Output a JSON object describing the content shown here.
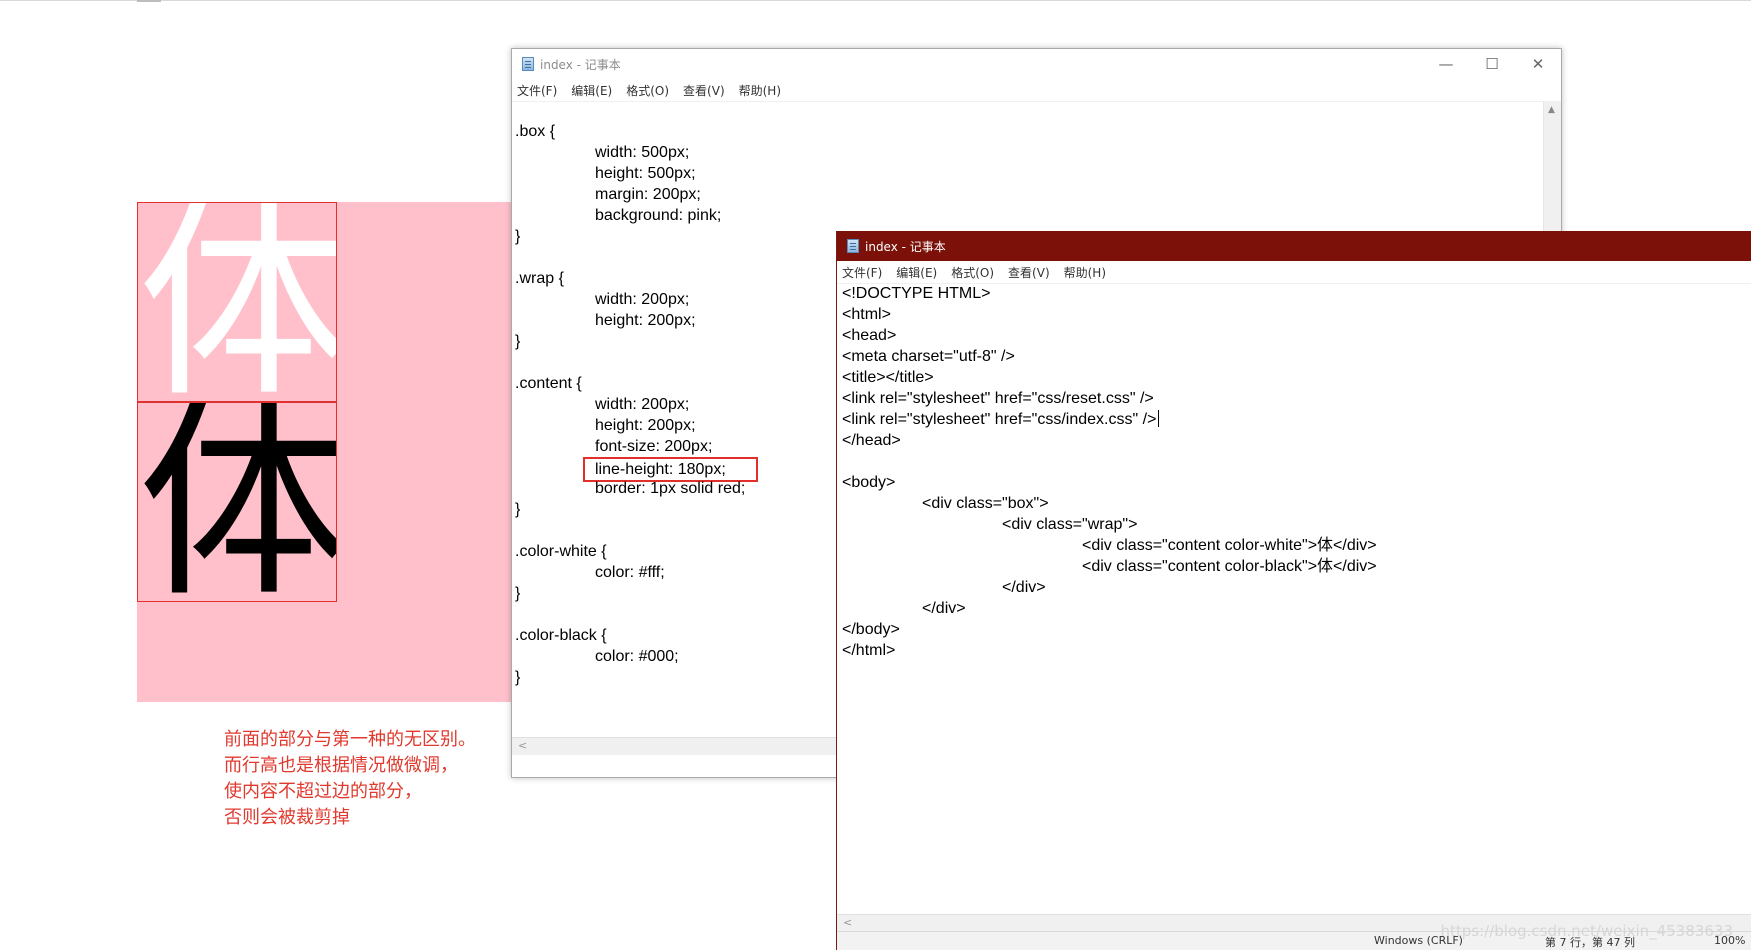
{
  "demo": {
    "white_glyph": "体",
    "black_glyph": "体",
    "caption": [
      "前面的部分与第一种的无区别。",
      "而行高也是根据情况做微调，",
      "使内容不超过边的部分，",
      "否则会被裁剪掉"
    ]
  },
  "window_back": {
    "title": "index - 记事本",
    "menu": [
      "文件(F)",
      "编辑(E)",
      "格式(O)",
      "查看(V)",
      "帮助(H)"
    ],
    "controls": {
      "minimize": "—",
      "maximize": "☐",
      "close": "✕"
    },
    "highlighted_line": "line-height: 180px;",
    "code": [
      {
        "indent": 0,
        "text": ".box {"
      },
      {
        "indent": 1,
        "text": "width: 500px;"
      },
      {
        "indent": 1,
        "text": "height: 500px;"
      },
      {
        "indent": 1,
        "text": "margin: 200px;"
      },
      {
        "indent": 1,
        "text": "background: pink;"
      },
      {
        "indent": 0,
        "text": "}"
      },
      {
        "indent": 0,
        "text": ""
      },
      {
        "indent": 0,
        "text": ".wrap {"
      },
      {
        "indent": 1,
        "text": "width: 200px;"
      },
      {
        "indent": 1,
        "text": "height: 200px;"
      },
      {
        "indent": 0,
        "text": "}"
      },
      {
        "indent": 0,
        "text": ""
      },
      {
        "indent": 0,
        "text": ".content {"
      },
      {
        "indent": 1,
        "text": "width: 200px;"
      },
      {
        "indent": 1,
        "text": "height: 200px;"
      },
      {
        "indent": 1,
        "text": "font-size: 200px;"
      },
      {
        "indent": 1,
        "text": "line-height: 180px;"
      },
      {
        "indent": 1,
        "text": "border: 1px solid red;"
      },
      {
        "indent": 0,
        "text": "}"
      },
      {
        "indent": 0,
        "text": ""
      },
      {
        "indent": 0,
        "text": ".color-white {"
      },
      {
        "indent": 1,
        "text": "color: #fff;"
      },
      {
        "indent": 0,
        "text": "}"
      },
      {
        "indent": 0,
        "text": ""
      },
      {
        "indent": 0,
        "text": ".color-black {"
      },
      {
        "indent": 1,
        "text": "color: #000;"
      },
      {
        "indent": 0,
        "text": "}"
      }
    ]
  },
  "window_front": {
    "title": "index - 记事本",
    "menu": [
      "文件(F)",
      "编辑(E)",
      "格式(O)",
      "查看(V)",
      "帮助(H)"
    ],
    "code": [
      {
        "indent": 0,
        "text": "<!DOCTYPE HTML>"
      },
      {
        "indent": 0,
        "text": "<html>"
      },
      {
        "indent": 0,
        "text": "<head>"
      },
      {
        "indent": 0,
        "text": "<meta charset=\"utf-8\" />"
      },
      {
        "indent": 0,
        "text": "<title></title>"
      },
      {
        "indent": 0,
        "text": "<link rel=\"stylesheet\" href=\"css/reset.css\" />"
      },
      {
        "indent": 0,
        "text": "<link rel=\"stylesheet\" href=\"css/index.css\" />"
      },
      {
        "indent": 0,
        "text": "</head>"
      },
      {
        "indent": 0,
        "text": ""
      },
      {
        "indent": 0,
        "text": "<body>"
      },
      {
        "indent": 1,
        "text": "<div class=\"box\">"
      },
      {
        "indent": 2,
        "text": "<div class=\"wrap\">"
      },
      {
        "indent": 3,
        "text": "<div class=\"content color-white\">体</div>"
      },
      {
        "indent": 3,
        "text": "<div class=\"content color-black\">体</div>"
      },
      {
        "indent": 2,
        "text": "</div>"
      },
      {
        "indent": 1,
        "text": "</div>"
      },
      {
        "indent": 0,
        "text": "</body>"
      },
      {
        "indent": 0,
        "text": "</html>"
      }
    ],
    "status": {
      "encoding": "Windows (CRLF)",
      "position": "第 7 行，第 47 列",
      "zoom": "100%"
    },
    "watermark": "https://blog.csdn.net/weixin_45383633"
  }
}
